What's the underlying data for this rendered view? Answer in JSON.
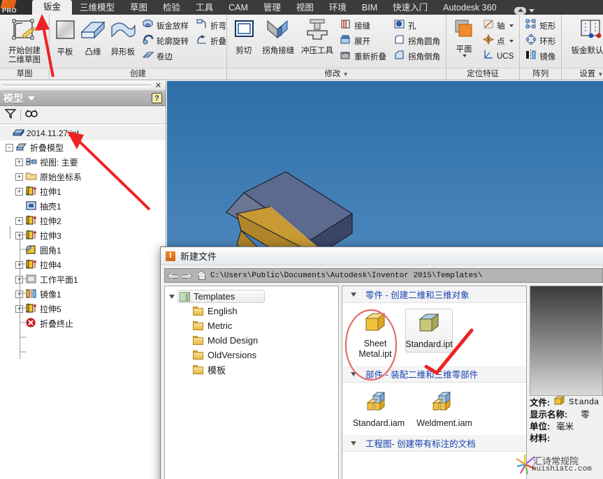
{
  "titlebar": {
    "logo": "PRO",
    "tabs": [
      {
        "label": "钣金",
        "active": true
      },
      {
        "label": "三维模型",
        "active": false
      },
      {
        "label": "草图",
        "active": false
      },
      {
        "label": "检验",
        "active": false
      },
      {
        "label": "工具",
        "active": false
      },
      {
        "label": "CAM",
        "active": false
      },
      {
        "label": "管理",
        "active": false
      },
      {
        "label": "视图",
        "active": false
      },
      {
        "label": "环境",
        "active": false
      },
      {
        "label": "BIM",
        "active": false
      },
      {
        "label": "快速入门",
        "active": false
      },
      {
        "label": "Autodesk 360",
        "active": false
      }
    ]
  },
  "ribbon": {
    "panels": [
      {
        "title": "草图",
        "has_dropdown": false,
        "big": [
          {
            "label_top": "开始创建",
            "label_bottom": "二维草图",
            "icon": "sketch-icon"
          }
        ],
        "small": []
      },
      {
        "title": "创建",
        "has_dropdown": false,
        "big": [
          {
            "label_top": "平板",
            "label_bottom": "",
            "icon": "flat-plate-icon"
          },
          {
            "label_top": "凸缘",
            "label_bottom": "",
            "icon": "flange-icon"
          },
          {
            "label_top": "异形板",
            "label_bottom": "",
            "icon": "contour-flange-icon"
          }
        ],
        "small": [
          {
            "label": "钣金放样",
            "icon": "lofted-flange-icon"
          },
          {
            "label": "轮廓旋转",
            "icon": "contour-roll-icon"
          },
          {
            "label": "卷边",
            "icon": "hem-icon"
          },
          {
            "label": "折弯",
            "icon": "bend-icon"
          },
          {
            "label": "折叠",
            "icon": "fold-icon"
          }
        ]
      },
      {
        "title": "修改",
        "has_dropdown": true,
        "big": [
          {
            "label_top": "剪切",
            "label_bottom": "",
            "icon": "cut-icon"
          },
          {
            "label_top": "拐角接缝",
            "label_bottom": "",
            "icon": "corner-seam-icon"
          },
          {
            "label_top": "冲压工具",
            "label_bottom": "",
            "icon": "punch-tool-icon"
          }
        ],
        "small": [
          {
            "label": "接缝",
            "icon": "rip-icon"
          },
          {
            "label": "展开",
            "icon": "unfold-icon"
          },
          {
            "label": "重新折叠",
            "icon": "refold-icon"
          },
          {
            "label": "孔",
            "icon": "hole-icon"
          },
          {
            "label": "拐角圆角",
            "icon": "corner-round-icon"
          },
          {
            "label": "拐角倒角",
            "icon": "corner-chamfer-icon"
          }
        ]
      },
      {
        "title": "定位特征",
        "has_dropdown": false,
        "big": [
          {
            "label_top": "平面",
            "label_bottom": "",
            "icon": "plane-icon"
          }
        ],
        "small": [
          {
            "label": "轴",
            "icon": "axis-icon",
            "dropdown": true
          },
          {
            "label": "点",
            "icon": "point-icon",
            "dropdown": true
          },
          {
            "label": "UCS",
            "icon": "ucs-icon"
          }
        ]
      },
      {
        "title": "阵列",
        "has_dropdown": false,
        "big": [],
        "small": [
          {
            "label": "矩形",
            "icon": "rect-pattern-icon"
          },
          {
            "label": "环形",
            "icon": "circular-pattern-icon"
          },
          {
            "label": "镜像",
            "icon": "mirror-icon"
          }
        ]
      },
      {
        "title": "设置",
        "has_dropdown": true,
        "big": [
          {
            "label_top": "钣金默认设",
            "label_bottom": "",
            "icon": "sheetmetal-defaults-icon"
          }
        ],
        "small": []
      }
    ]
  },
  "browser": {
    "title": "模型",
    "help_badge": "?",
    "close": "✕",
    "toolbar": [
      {
        "name": "filter-icon"
      },
      {
        "name": "find-icon"
      }
    ],
    "tree": [
      {
        "label": "2014.11.27.ipt",
        "indent": 0,
        "expander": "none",
        "icon": "part-icon",
        "root": true
      },
      {
        "label": "折叠模型",
        "indent": 1,
        "expander": "minus",
        "icon": "folded-model-icon"
      },
      {
        "label": "视图: 主要",
        "indent": 2,
        "expander": "plus",
        "icon": "view-icon"
      },
      {
        "label": "原始坐标系",
        "indent": 2,
        "expander": "plus",
        "icon": "origin-folder-icon"
      },
      {
        "label": "拉伸1",
        "indent": 2,
        "expander": "plus",
        "icon": "extrude-icon"
      },
      {
        "label": "抽壳1",
        "indent": 2,
        "expander": "none",
        "icon": "shell-icon"
      },
      {
        "label": "拉伸2",
        "indent": 2,
        "expander": "plus",
        "icon": "extrude-icon"
      },
      {
        "label": "拉伸3",
        "indent": 2,
        "expander": "plus",
        "icon": "extrude-icon"
      },
      {
        "label": "圆角1",
        "indent": 2,
        "expander": "none",
        "icon": "fillet-icon"
      },
      {
        "label": "拉伸4",
        "indent": 2,
        "expander": "plus",
        "icon": "extrude-icon"
      },
      {
        "label": "工作平面1",
        "indent": 2,
        "expander": "plus",
        "icon": "workplane-icon"
      },
      {
        "label": "镜像1",
        "indent": 2,
        "expander": "plus",
        "icon": "mirror-feature-icon"
      },
      {
        "label": "拉伸5",
        "indent": 2,
        "expander": "plus",
        "icon": "extrude-icon"
      },
      {
        "label": "折叠终止",
        "indent": 2,
        "expander": "none",
        "icon": "end-of-part-icon"
      }
    ]
  },
  "dialog": {
    "title": "新建文件",
    "app_icon": "inventor-icon",
    "path": "C:\\Users\\Public\\Documents\\Autodesk\\Inventor 2015\\Templates\\",
    "nav": {
      "back": "back-arrow-icon",
      "forward": "forward-arrow-icon",
      "home": "home-icon"
    },
    "folders": [
      {
        "label": "Templates",
        "level": 0,
        "selected": true,
        "icon": "templates-icon"
      },
      {
        "label": "English",
        "level": 1,
        "selected": false,
        "icon": "folder-icon"
      },
      {
        "label": "Metric",
        "level": 1,
        "selected": false,
        "icon": "folder-icon"
      },
      {
        "label": "Mold Design",
        "level": 1,
        "selected": false,
        "icon": "folder-icon"
      },
      {
        "label": "OldVersions",
        "level": 1,
        "selected": false,
        "icon": "folder-icon"
      },
      {
        "label": "模板",
        "level": 1,
        "selected": false,
        "icon": "folder-icon"
      }
    ],
    "sections": [
      {
        "header": "零件 - 创建二维和三维对象",
        "tiles": [
          {
            "label": "Sheet Metal.ipt",
            "icon": "yellow-cube-icon",
            "selected": false
          },
          {
            "label": "Standard.ipt",
            "icon": "olive-cube-icon",
            "selected": true
          }
        ]
      },
      {
        "header": "部件 - 装配二维和三维零部件",
        "tiles": [
          {
            "label": "Standard.iam",
            "icon": "assembly-icon",
            "selected": false
          },
          {
            "label": "Weldment.iam",
            "icon": "assembly-icon",
            "selected": false
          }
        ]
      },
      {
        "header": "工程图- 创建带有标注的文档",
        "tiles": []
      }
    ],
    "info": [
      {
        "key": "文件:",
        "value": "Standa",
        "has_icon": true
      },
      {
        "key": "显示名称:",
        "value": "零",
        "has_icon": false
      },
      {
        "key": "单位:",
        "value": "毫米",
        "has_icon": false
      },
      {
        "key": "材料:",
        "value": "",
        "has_icon": false
      }
    ]
  },
  "watermark": {
    "domain": "huishiatc.com",
    "cn": "汇诗常规院"
  },
  "colors": {
    "tabbar_bg": "#3b3b3b",
    "active_tab": "#efefef",
    "ribbon_bg": "#eaeaea",
    "viewport_top": "#2e6ea8",
    "viewport_bottom": "#cfd9e2",
    "model_gold": "#c79a33",
    "model_blue": "#3d4a72",
    "annotation_red": "#ee2222",
    "link_blue": "#1540b0"
  }
}
